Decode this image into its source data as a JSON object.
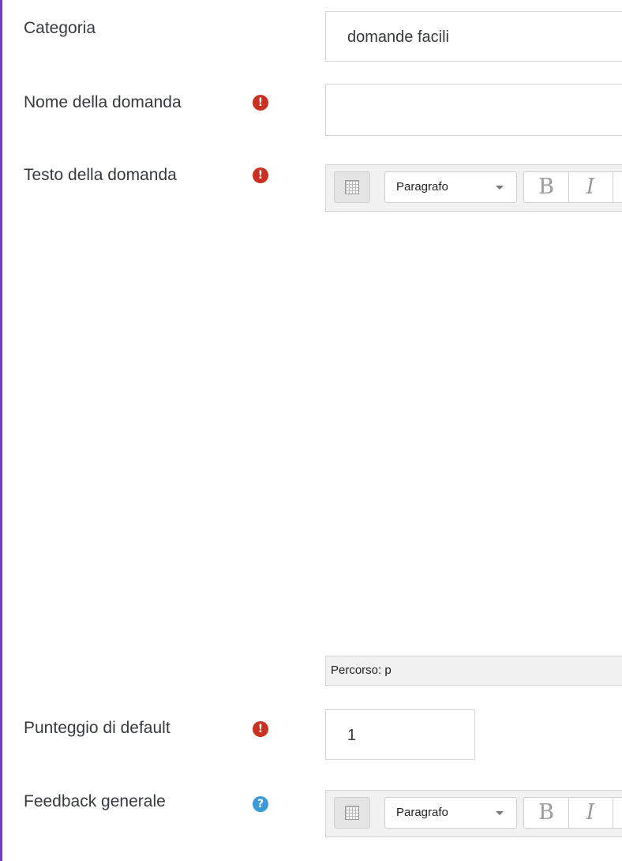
{
  "form": {
    "category": {
      "label": "Categoria",
      "value": "domande facili"
    },
    "question_name": {
      "label": "Nome della domanda",
      "value": "",
      "required_icon": "exclamation-circle-icon"
    },
    "question_text": {
      "label": "Testo della domanda",
      "required_icon": "exclamation-circle-icon",
      "toolbar": {
        "paragraph_select": "Paragrafo",
        "bold_label": "B",
        "italic_label": "I"
      },
      "path_text": "Percorso: p"
    },
    "default_mark": {
      "label": "Punteggio di default",
      "value": "1",
      "required_icon": "exclamation-circle-icon"
    },
    "general_feedback": {
      "label": "Feedback generale",
      "help_icon": "question-circle-icon",
      "toolbar": {
        "paragraph_select": "Paragrafo",
        "bold_label": "B",
        "italic_label": "I"
      }
    }
  },
  "colors": {
    "required": "#ca3120",
    "help": "#3a9bd8",
    "left_border": "#6c3cc4"
  }
}
